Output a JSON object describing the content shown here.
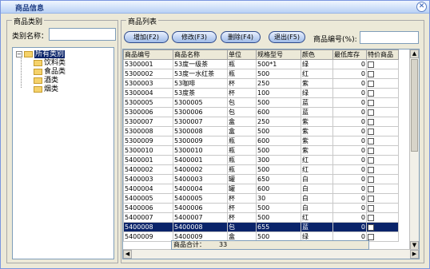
{
  "window": {
    "title": "商品信息",
    "close_label": "✕"
  },
  "category_panel": {
    "legend": "商品类别",
    "name_label": "类别名称：",
    "name_value": "",
    "tree": {
      "root": "所有类别",
      "children": [
        "饮料类",
        "食品类",
        "酒类",
        "烟类"
      ]
    }
  },
  "list_panel": {
    "legend": "商品列表",
    "buttons": [
      {
        "label": "增加(F2)"
      },
      {
        "label": "修改(F3)"
      },
      {
        "label": "删除(F4)"
      },
      {
        "label": "退出(F5)"
      }
    ],
    "code_label": "商品编号(%):",
    "code_value": "",
    "columns": [
      "商品编号",
      "商品名称",
      "单位",
      "规格型号",
      "颜色",
      "最低库存",
      "特价商品"
    ],
    "rows": [
      [
        "5300001",
        "53度一级茶",
        "瓶",
        "500*1",
        "绿",
        "0"
      ],
      [
        "5300002",
        "53度一水红茶",
        "瓶",
        "500",
        "红",
        "0"
      ],
      [
        "5300003",
        "53咖啡",
        "杯",
        "250",
        "紫",
        "0"
      ],
      [
        "5300004",
        "53度茶",
        "杯",
        "100",
        "绿",
        "0"
      ],
      [
        "5300005",
        "5300005",
        "包",
        "500",
        "蓝",
        "0"
      ],
      [
        "5300006",
        "5300006",
        "包",
        "600",
        "蓝",
        "0"
      ],
      [
        "5300007",
        "5300007",
        "盒",
        "250",
        "紫",
        "0"
      ],
      [
        "5300008",
        "5300008",
        "盒",
        "500",
        "紫",
        "0"
      ],
      [
        "5300009",
        "5300009",
        "瓶",
        "600",
        "紫",
        "0"
      ],
      [
        "5300010",
        "5300010",
        "瓶",
        "500",
        "紫",
        "0"
      ],
      [
        "5400001",
        "5400001",
        "瓶",
        "300",
        "红",
        "0"
      ],
      [
        "5400002",
        "5400002",
        "瓶",
        "500",
        "红",
        "0"
      ],
      [
        "5400003",
        "5400003",
        "罐",
        "650",
        "白",
        "0"
      ],
      [
        "5400004",
        "5400004",
        "罐",
        "600",
        "白",
        "0"
      ],
      [
        "5400005",
        "5400005",
        "杯",
        "30",
        "白",
        "0"
      ],
      [
        "5400006",
        "5400006",
        "杯",
        "500",
        "白",
        "0"
      ],
      [
        "5400007",
        "5400007",
        "杯",
        "500",
        "红",
        "0"
      ],
      [
        "5400008",
        "5400008",
        "包",
        "655",
        "蓝",
        "0"
      ],
      [
        "5400009",
        "5400009",
        "盒",
        "500",
        "绿",
        "0"
      ]
    ],
    "selected_row_index": 17,
    "total_label": "商品合计：",
    "total_value": "33"
  }
}
